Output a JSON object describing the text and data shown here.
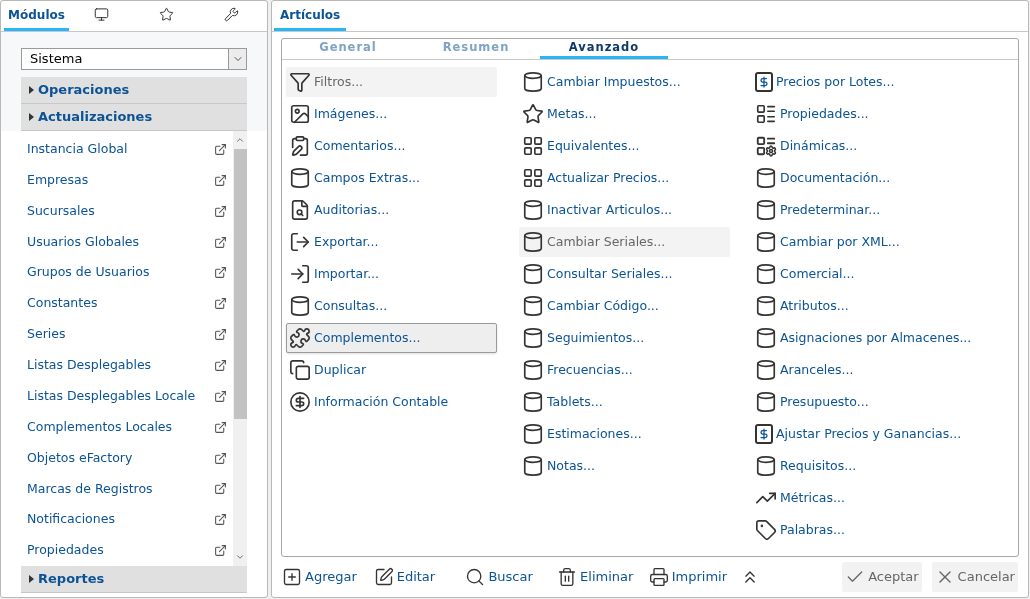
{
  "sidebar": {
    "tabs": [
      {
        "kind": "text",
        "label": "Módulos",
        "selected": true
      },
      {
        "kind": "monitor",
        "selected": false
      },
      {
        "kind": "star",
        "selected": false
      },
      {
        "kind": "wrench",
        "selected": false
      }
    ],
    "module_select": {
      "value": "Sistema"
    },
    "sections_top": [
      {
        "label": "Operaciones",
        "expanded": false
      },
      {
        "label": "Actualizaciones",
        "expanded": false
      }
    ],
    "items": [
      "Instancia Global",
      "Empresas",
      "Sucursales",
      "Usuarios Globales",
      "Grupos de Usuarios",
      "Constantes",
      "Series",
      "Listas Desplegables",
      "Listas Desplegables Locale",
      "Complementos Locales",
      "Objetos eFactory",
      "Marcas de Registros",
      "Notificaciones",
      "Propiedades"
    ],
    "sections_bottom": [
      {
        "label": "Reportes",
        "expanded": false
      }
    ]
  },
  "main": {
    "tab": {
      "label": "Artículos",
      "selected": true
    },
    "subtabs": [
      {
        "label": "General",
        "selected": false
      },
      {
        "label": "Resumen",
        "selected": false
      },
      {
        "label": "Avanzado",
        "selected": true
      }
    ],
    "columns": [
      [
        {
          "label": "Filtros...",
          "kind": "filter",
          "disabled": true,
          "focused": false
        },
        {
          "label": "Imágenes...",
          "kind": "image",
          "disabled": false,
          "focused": false
        },
        {
          "label": "Comentarios...",
          "kind": "clipboard",
          "disabled": false,
          "focused": false
        },
        {
          "label": "Campos Extras...",
          "kind": "database",
          "disabled": false,
          "focused": false
        },
        {
          "label": "Auditorias...",
          "kind": "audit",
          "disabled": false,
          "focused": false
        },
        {
          "label": "Exportar...",
          "kind": "export",
          "disabled": false,
          "focused": false
        },
        {
          "label": "Importar...",
          "kind": "import",
          "disabled": false,
          "focused": false
        },
        {
          "label": "Consultas...",
          "kind": "database",
          "disabled": false,
          "focused": false
        },
        {
          "label": "Complementos...",
          "kind": "puzzle",
          "disabled": false,
          "focused": true
        },
        {
          "label": "Duplicar",
          "kind": "copy",
          "disabled": false,
          "focused": false
        },
        {
          "label": "Información Contable",
          "kind": "dollar-circle",
          "disabled": false,
          "focused": false
        }
      ],
      [
        {
          "label": "Cambiar Impuestos...",
          "kind": "database",
          "disabled": false,
          "focused": false
        },
        {
          "label": "Metas...",
          "kind": "star",
          "disabled": false,
          "focused": false
        },
        {
          "label": "Equivalentes...",
          "kind": "grid",
          "disabled": false,
          "focused": false
        },
        {
          "label": "Actualizar Precios...",
          "kind": "grid",
          "disabled": false,
          "focused": false
        },
        {
          "label": "Inactivar Articulos...",
          "kind": "database",
          "disabled": false,
          "focused": false
        },
        {
          "label": "Cambiar Seriales...",
          "kind": "database",
          "disabled": true,
          "focused": false
        },
        {
          "label": "Consultar Seriales...",
          "kind": "database",
          "disabled": false,
          "focused": false
        },
        {
          "label": "Cambiar Código...",
          "kind": "database",
          "disabled": false,
          "focused": false
        },
        {
          "label": "Seguimientos...",
          "kind": "database",
          "disabled": false,
          "focused": false
        },
        {
          "label": "Frecuencias...",
          "kind": "database",
          "disabled": false,
          "focused": false
        },
        {
          "label": "Tablets...",
          "kind": "database",
          "disabled": false,
          "focused": false
        },
        {
          "label": "Estimaciones...",
          "kind": "database",
          "disabled": false,
          "focused": false
        },
        {
          "label": "Notas...",
          "kind": "database",
          "disabled": false,
          "focused": false
        }
      ],
      [
        {
          "label": "Precios por Lotes...",
          "kind": "dollar-square",
          "disabled": false,
          "focused": false
        },
        {
          "label": "Propiedades...",
          "kind": "list-grid",
          "disabled": false,
          "focused": false
        },
        {
          "label": "Dinámicas...",
          "kind": "grid-gear",
          "disabled": false,
          "focused": false
        },
        {
          "label": "Documentación...",
          "kind": "database",
          "disabled": false,
          "focused": false
        },
        {
          "label": "Predeterminar...",
          "kind": "database",
          "disabled": false,
          "focused": false
        },
        {
          "label": "Cambiar por XML...",
          "kind": "database",
          "disabled": false,
          "focused": false
        },
        {
          "label": "Comercial...",
          "kind": "database",
          "disabled": false,
          "focused": false
        },
        {
          "label": "Atributos...",
          "kind": "database",
          "disabled": false,
          "focused": false
        },
        {
          "label": "Asignaciones por Almacenes...",
          "kind": "database",
          "disabled": false,
          "focused": false
        },
        {
          "label": "Aranceles...",
          "kind": "database",
          "disabled": false,
          "focused": false
        },
        {
          "label": "Presupuesto...",
          "kind": "database",
          "disabled": false,
          "focused": false
        },
        {
          "label": "Ajustar Precios y Ganancias...",
          "kind": "dollar-square",
          "disabled": false,
          "focused": false
        },
        {
          "label": "Requisitos...",
          "kind": "database",
          "disabled": false,
          "focused": false
        },
        {
          "label": "Métricas...",
          "kind": "chart",
          "disabled": false,
          "focused": false
        },
        {
          "label": "Palabras...",
          "kind": "tag",
          "disabled": false,
          "focused": false
        }
      ]
    ],
    "toolbar": [
      {
        "label": "Agregar",
        "kind": "add"
      },
      {
        "label": "Editar",
        "kind": "edit"
      },
      {
        "label": "Buscar",
        "kind": "search"
      },
      {
        "label": "Eliminar",
        "kind": "delete"
      },
      {
        "label": "Imprimir",
        "kind": "print"
      },
      {
        "kind": "collapse"
      }
    ],
    "actions": [
      {
        "label": "Aceptar",
        "kind": "accept"
      },
      {
        "label": "Cancelar",
        "kind": "cancel"
      }
    ]
  }
}
